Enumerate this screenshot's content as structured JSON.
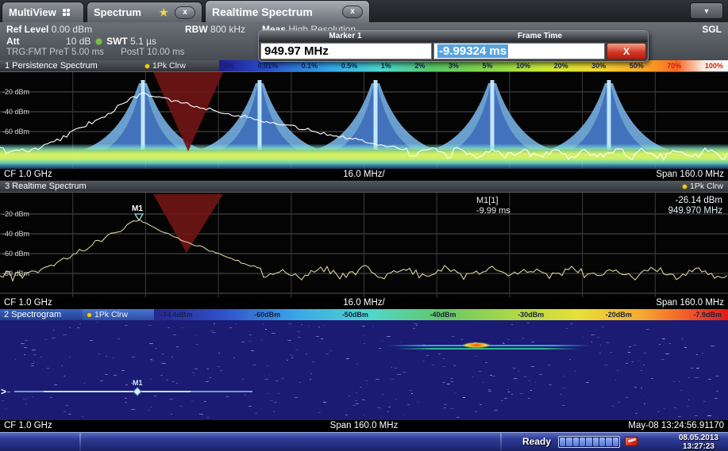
{
  "window": {
    "tabs": [
      {
        "label": "MultiView"
      },
      {
        "label": "Spectrum"
      },
      {
        "label": "Realtime Spectrum"
      }
    ],
    "close_label": "x",
    "sgl": "SGL"
  },
  "settings": {
    "ref_level_label": "Ref Level",
    "ref_level": "0.00 dBm",
    "att_label": "Att",
    "att": "10 dB",
    "swt_label": "SWT",
    "swt": "5.1 µs",
    "rbw_label": "RBW",
    "rbw": "800 kHz",
    "meas_label": "Meas",
    "meas": "High Resolution",
    "trigger": "TRG:FMT PreT 5.00 ms",
    "trigger_post": "PostT 10.00 ms"
  },
  "marker_dialog": {
    "marker_title": "Marker 1",
    "marker_value": "949.97 MHz",
    "frame_title": "Frame Time",
    "frame_value": "-9.99324 ms",
    "close": "X"
  },
  "persistence": {
    "title": "1 Persistence Spectrum",
    "trace_label": "1Pk Clrw",
    "scale_labels": [
      "0%",
      "0.01%",
      "0.1%",
      "0.5%",
      "1%",
      "2%",
      "3%",
      "5%",
      "10%",
      "20%",
      "30%",
      "50%",
      "70%",
      "100%"
    ],
    "y_labels": [
      "-20 dBm",
      "-40 dBm",
      "-60 dBm"
    ],
    "cf": "CF 1.0 GHz",
    "per_div": "16.0 MHz/",
    "span": "Span 160.0 MHz"
  },
  "realtime": {
    "title": "3 Realtime Spectrum",
    "trace_label": "1Pk Clrw",
    "y_labels": [
      "-20 dBm",
      "-40 dBm",
      "-60 dBm",
      "-80 dBm"
    ],
    "marker_name": "M1",
    "marker_id": "M1[1]",
    "marker_time": "-9.99 ms",
    "marker_level": "-26.14 dBm",
    "marker_freq": "949.970 MHz",
    "cf": "CF 1.0 GHz",
    "per_div": "16.0 MHz/",
    "span": "Span 160.0 MHz"
  },
  "spectrogram": {
    "title": "2 Spectrogram",
    "trace_label": "1Pk Clrw",
    "scale_labels": [
      "-74.4dBm",
      "-60dBm",
      "-50dBm",
      "-40dBm",
      "-30dBm",
      "-20dBm",
      "-7.9dBm"
    ],
    "marker_name": "M1",
    "cf": "CF 1.0 GHz",
    "span": "Span 160.0 MHz",
    "timestamp": "May-08 13:24:56.91170"
  },
  "statusbar": {
    "ready": "Ready",
    "date": "08.05.2013",
    "time": "13:27:23"
  }
}
